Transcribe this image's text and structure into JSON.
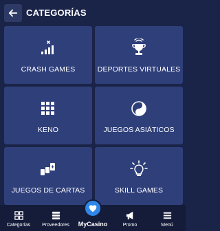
{
  "header": {
    "title": "CATEGORÍAS",
    "back_icon": "arrow-left-icon"
  },
  "categories": [
    {
      "label": "CRASH GAMES",
      "icon": "signal-bars-icon"
    },
    {
      "label": "DEPORTES VIRTUALES",
      "icon": "trophy-icon"
    },
    {
      "label": "KENO",
      "icon": "keno-grid-icon"
    },
    {
      "label": "JUEGOS ASIÁTICOS",
      "icon": "yin-yang-icon"
    },
    {
      "label": "JUEGOS DE CARTAS",
      "icon": "cards-icon"
    },
    {
      "label": "SKILL GAMES",
      "icon": "lightbulb-icon"
    }
  ],
  "bottom_nav": [
    {
      "label": "Categorías",
      "icon": "categories-grid-icon"
    },
    {
      "label": "Proveedores",
      "icon": "providers-stack-icon"
    },
    {
      "label": "MyCasino",
      "icon": "heart-icon"
    },
    {
      "label": "Promo",
      "icon": "megaphone-icon"
    },
    {
      "label": "Menú",
      "icon": "hamburger-icon"
    }
  ],
  "colors": {
    "background": "#1a2348",
    "tile": "#2f3f7a",
    "nav_background": "#151c3a",
    "accent": "#2f88e8"
  }
}
